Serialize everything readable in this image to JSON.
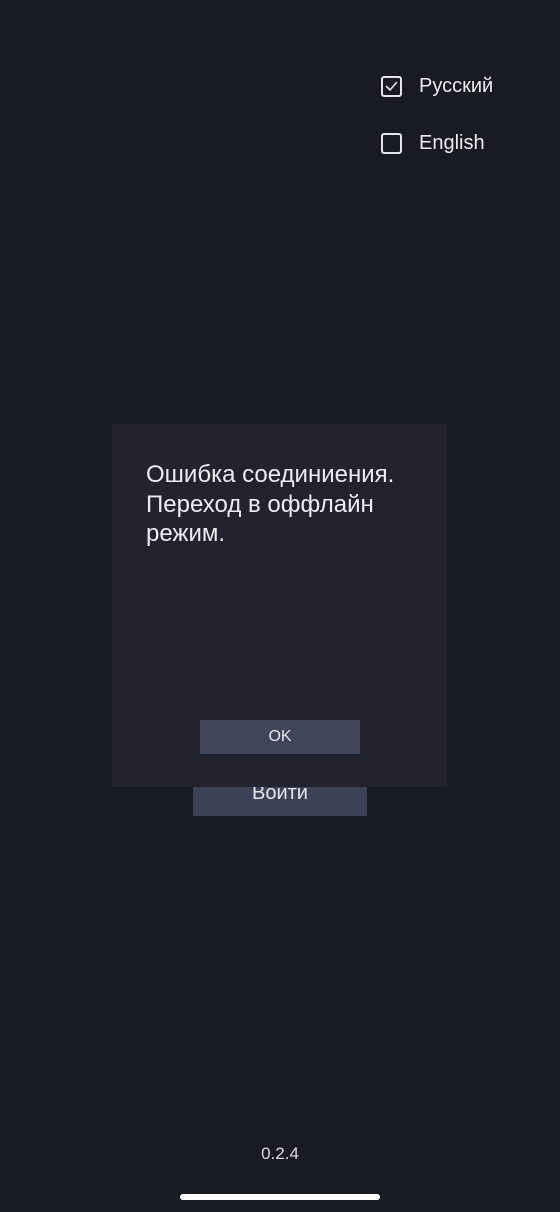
{
  "languages": [
    {
      "label": "Русский",
      "checked": true
    },
    {
      "label": "English",
      "checked": false
    }
  ],
  "login_button": {
    "label": "Войти"
  },
  "dialog": {
    "message": "Ошибка соединиения. Переход в оффлайн режим.",
    "ok_label": "OK"
  },
  "version": "0.2.4",
  "colors": {
    "background": "#181b22",
    "dialog_background": "#22232f",
    "button_background": "#3d4155",
    "text": "#ececf0"
  }
}
